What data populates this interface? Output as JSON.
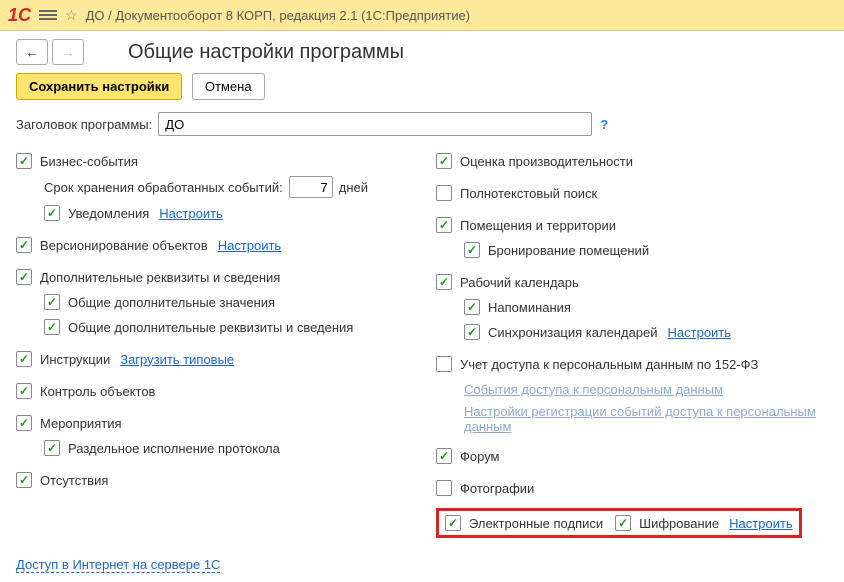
{
  "header": {
    "title": "ДО / Документооборот 8 КОРП, редакция 2.1  (1С:Предприятие)"
  },
  "page": {
    "title": "Общие настройки программы"
  },
  "cmd": {
    "save": "Сохранить настройки",
    "cancel": "Отмена"
  },
  "prog": {
    "label": "Заголовок программы:",
    "value": "ДО",
    "help": "?"
  },
  "left": {
    "biz": "Бизнес-события",
    "biz_retain_label": "Срок хранения обработанных событий:",
    "biz_retain_value": "7",
    "biz_retain_unit": "дней",
    "biz_notif": "Уведомления",
    "biz_notif_cfg": "Настроить",
    "versioning": "Версионирование объектов",
    "versioning_cfg": "Настроить",
    "extra": "Дополнительные реквизиты и сведения",
    "extra_common_values": "Общие дополнительные значения",
    "extra_common_attrs": "Общие дополнительные реквизиты и сведения",
    "instr": "Инструкции",
    "instr_load": "Загрузить типовые",
    "obj_ctrl": "Контроль объектов",
    "events": "Мероприятия",
    "events_split": "Раздельное исполнение протокола",
    "absence": "Отсутствия"
  },
  "right": {
    "perf": "Оценка производительности",
    "fulltext": "Полнотекстовый поиск",
    "rooms": "Помещения и территории",
    "rooms_book": "Бронирование помещений",
    "cal": "Рабочий календарь",
    "cal_remind": "Напоминания",
    "cal_sync": "Синхронизация календарей",
    "cal_sync_cfg": "Настроить",
    "pd152": "Учет доступа к персональным данным по 152-ФЗ",
    "pd152_events": "События доступа к персональным данным",
    "pd152_settings": "Настройки регистрации событий доступа к персональным данным",
    "forum": "Форум",
    "photos": "Фотографии",
    "esign": "Электронные подписи",
    "encrypt": "Шифрование",
    "esign_cfg": "Настроить"
  },
  "footer": {
    "inet": "Доступ в Интернет на сервере 1С"
  }
}
